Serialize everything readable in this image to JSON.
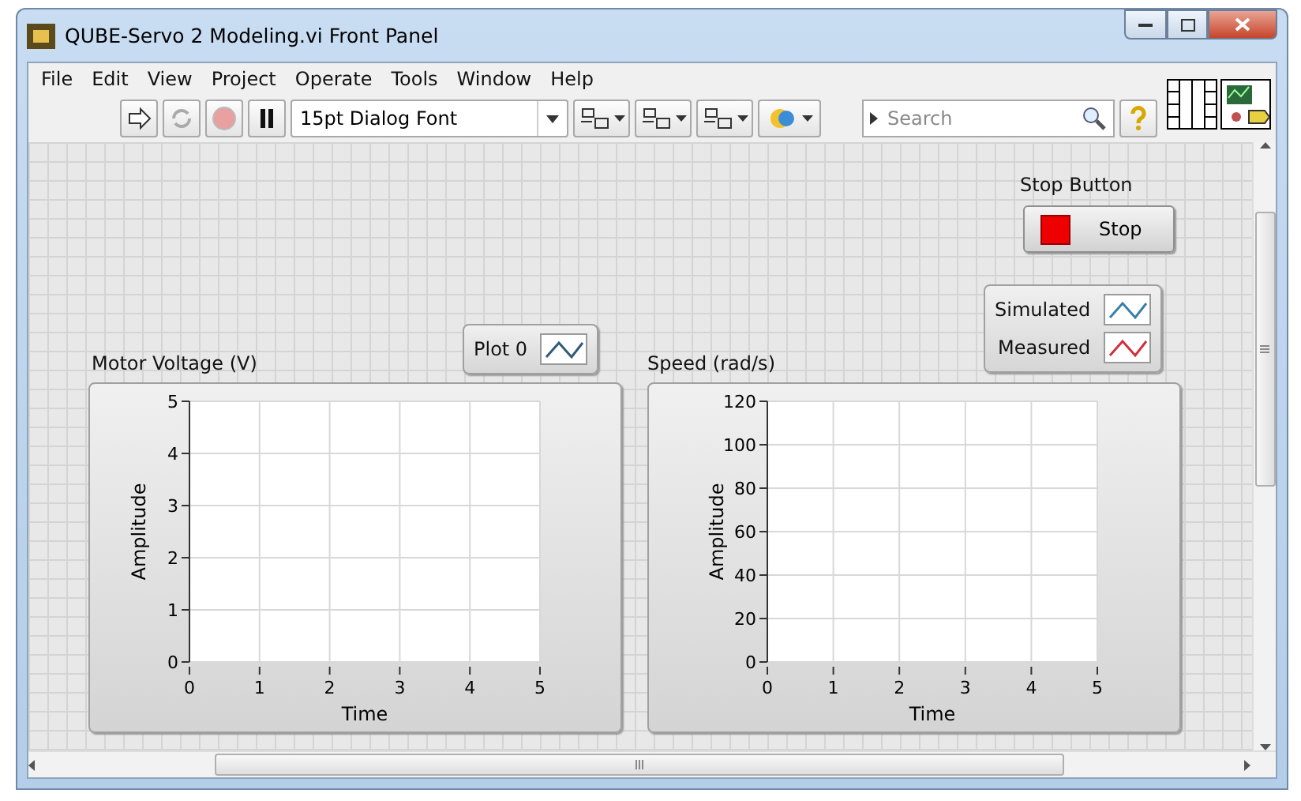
{
  "window": {
    "title": "QUBE-Servo 2 Modeling.vi Front Panel"
  },
  "menu": [
    "File",
    "Edit",
    "View",
    "Project",
    "Operate",
    "Tools",
    "Window",
    "Help"
  ],
  "toolbar": {
    "font": "15pt Dialog Font",
    "search": {
      "placeholder": "Search"
    }
  },
  "stop": {
    "label": "Stop Button",
    "text": "Stop"
  },
  "graphs": [
    {
      "label": "Motor Voltage (V)",
      "legend": [
        {
          "name": "Plot 0",
          "color": "#2f5a78"
        }
      ],
      "chart_data": {
        "type": "line",
        "grid": true,
        "xlabel": "Time",
        "ylabel": "Amplitude",
        "xlim": [
          0,
          5
        ],
        "ylim": [
          0,
          5
        ],
        "xticks": [
          0,
          1,
          2,
          3,
          4,
          5
        ],
        "yticks": [
          0,
          1,
          2,
          3,
          4,
          5
        ]
      }
    },
    {
      "label": "Speed (rad/s)",
      "legend": [
        {
          "name": "Simulated",
          "color": "#3a7fa8"
        },
        {
          "name": "Measured",
          "color": "#d0303c"
        }
      ],
      "chart_data": {
        "type": "line",
        "grid": true,
        "xlabel": "Time",
        "ylabel": "Amplitude",
        "xlim": [
          0,
          5
        ],
        "ylim": [
          0,
          120
        ],
        "xticks": [
          0,
          1,
          2,
          3,
          4,
          5
        ],
        "yticks": [
          0,
          20,
          40,
          60,
          80,
          100,
          120
        ]
      }
    }
  ]
}
